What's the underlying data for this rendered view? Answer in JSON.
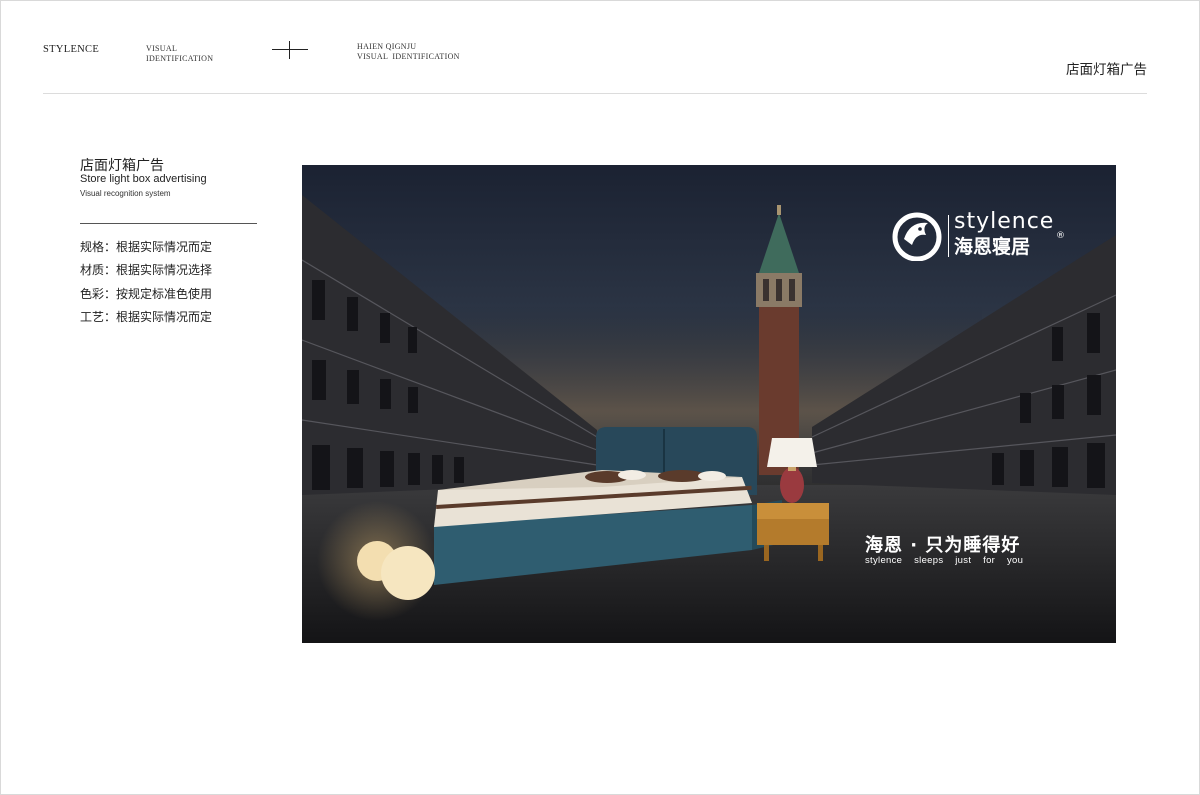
{
  "header": {
    "brand": "STYLENCE",
    "visual_line1": "VISUAL",
    "visual_line2": "IDENTIFICATION",
    "haien_line1": "HAIEN QIGNJU",
    "haien_line2": "VISUAL  IDENTIFICATION",
    "section_title": "店面灯箱广告"
  },
  "panel": {
    "title": "店面灯箱广告",
    "subtitle": "Store light box advertising",
    "caption": "Visual recognition system",
    "specs": [
      "规格：根据实际情况而定",
      "材质：根据实际情况选择",
      "色彩：按规定标准色使用",
      "工艺：根据实际情况而定"
    ]
  },
  "poster": {
    "logo_en": "stylence",
    "logo_cn": "海恩寝居",
    "logo_reg": "®",
    "slogan_cn": "海恩 · 只为睡得好",
    "slogan_en": "stylence  sleeps  just  for  you"
  },
  "icons": [
    "plus-divider-icon",
    "dolphin-logo-icon"
  ]
}
